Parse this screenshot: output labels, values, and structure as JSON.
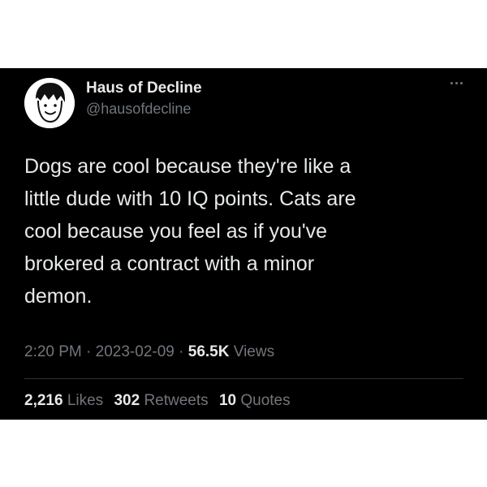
{
  "author": {
    "display_name": "Haus of Decline",
    "handle": "@hausofdecline",
    "avatar_icon": "cartoon-face-avatar"
  },
  "more_icon": "ellipsis-icon",
  "tweet": {
    "text": "Dogs are cool because they're like a\nlittle dude with 10 IQ points. Cats are\ncool because you feel as if you've\nbrokered a contract with a minor\ndemon."
  },
  "meta": {
    "time": "2:20 PM",
    "separator": " · ",
    "date": "2023-02-09",
    "views_count": "56.5K",
    "views_label": "Views"
  },
  "stats": {
    "likes_count": "2,216",
    "likes_label": "Likes",
    "retweets_count": "302",
    "retweets_label": "Retweets",
    "quotes_count": "10",
    "quotes_label": "Quotes"
  },
  "colors": {
    "background": "#000000",
    "primary_text": "#e7e9ea",
    "secondary_text": "#71767b",
    "divider": "#2f3336"
  }
}
